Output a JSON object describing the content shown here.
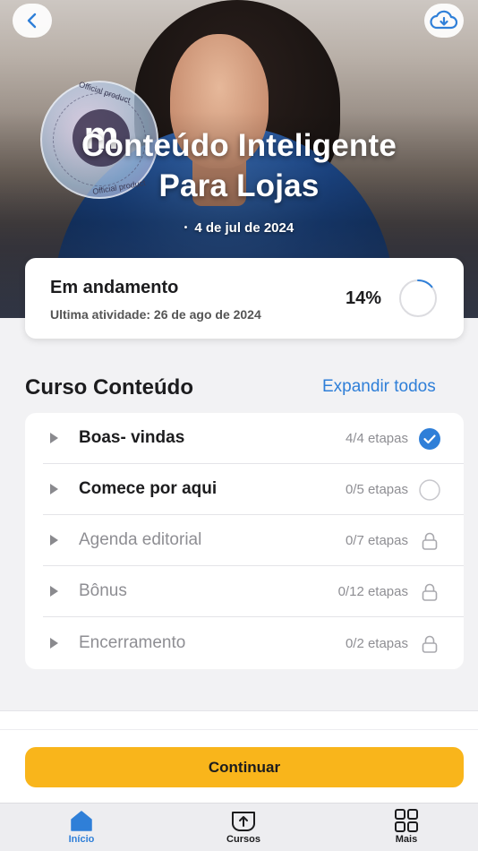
{
  "header": {
    "title_line1": "Conteúdo Inteligente",
    "title_line2": "Para Lojas",
    "date": "4 de jul de 2024",
    "back_icon": "chevron-left-icon",
    "download_icon": "cloud-download-icon"
  },
  "seal": {
    "letter": "m",
    "text_top": "Official product",
    "text_bottom": "Official product"
  },
  "progress": {
    "status": "Em andamento",
    "last_activity": "Ultima atividade: 26 de ago de 2024",
    "percent_label": "14%",
    "percent_value": 0.14
  },
  "section": {
    "title": "Curso Conteúdo",
    "expand_label": "Expandir todos"
  },
  "modules": [
    {
      "name": "Boas- vindas",
      "steps": "4/4 etapas",
      "state": "completed",
      "icon": "check-circle-icon"
    },
    {
      "name": "Comece por aqui",
      "steps": "0/5 etapas",
      "state": "open",
      "icon": "empty-circle-icon"
    },
    {
      "name": "Agenda editorial",
      "steps": "0/7 etapas",
      "state": "locked",
      "icon": "lock-icon"
    },
    {
      "name": "Bônus",
      "steps": "0/12 etapas",
      "state": "locked",
      "icon": "lock-icon"
    },
    {
      "name": "Encerramento",
      "steps": "0/2 etapas",
      "state": "locked",
      "icon": "lock-icon"
    }
  ],
  "cta": {
    "label": "Continuar"
  },
  "tabs": [
    {
      "label": "Início",
      "icon": "home-icon",
      "active": true
    },
    {
      "label": "Cursos",
      "icon": "courses-icon",
      "active": false
    },
    {
      "label": "Mais",
      "icon": "grid-icon",
      "active": false
    }
  ],
  "colors": {
    "accent": "#2f7fd8",
    "button": "#f9b51b",
    "background": "#f2f2f4"
  }
}
